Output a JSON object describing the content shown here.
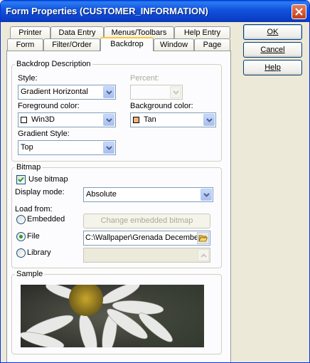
{
  "window": {
    "title": "Form Properties (CUSTOMER_INFORMATION)"
  },
  "tabs": {
    "row1": [
      "Printer",
      "Data Entry",
      "Menus/Toolbars",
      "Help Entry"
    ],
    "row2": [
      "Form",
      "Filter/Order",
      "Backdrop",
      "Window",
      "Page"
    ],
    "active": "Backdrop"
  },
  "backdrop": {
    "group_label": "Backdrop Description",
    "style_label": "Style:",
    "style_value": "Gradient Horizontal",
    "percent_label": "Percent:",
    "percent_value": "",
    "fg_label": "Foreground color:",
    "fg_value": "Win3D",
    "fg_color": "#ffffff",
    "bg_label": "Background color:",
    "bg_value": "Tan",
    "bg_color": "#f2b27a",
    "gradient_label": "Gradient Style:",
    "gradient_value": "Top"
  },
  "bitmap": {
    "group_label": "Bitmap",
    "use_bitmap_label": "Use bitmap",
    "use_bitmap_checked": true,
    "display_mode_label": "Display mode:",
    "display_mode_value": "Absolute",
    "load_from_label": "Load from:",
    "embedded_label": "Embedded",
    "change_button": "Change embedded bitmap",
    "file_label": "File",
    "file_path": "C:\\Wallpaper\\Grenada December",
    "library_label": "Library",
    "library_value": "",
    "selected": "File"
  },
  "sample": {
    "group_label": "Sample"
  },
  "buttons": {
    "ok": "OK",
    "cancel": "Cancel",
    "help": "Help"
  }
}
